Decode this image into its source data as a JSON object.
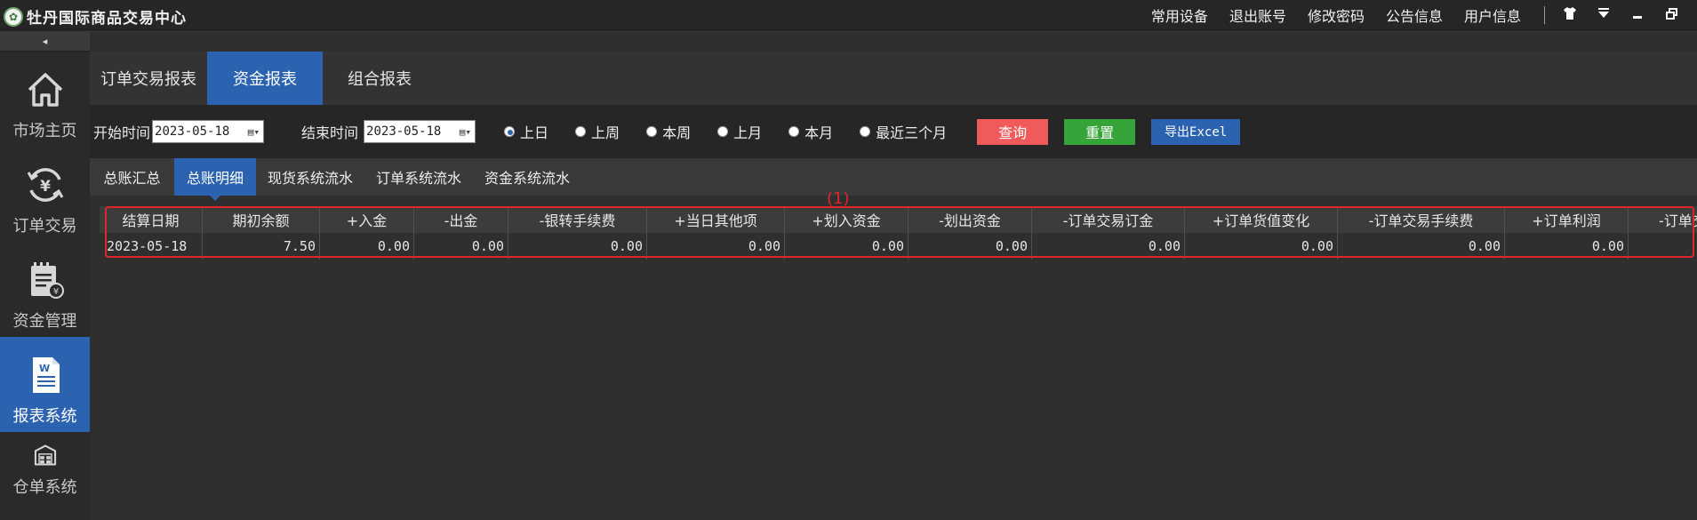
{
  "app": {
    "title": "牡丹国际商品交易中心"
  },
  "top_menu": [
    "常用设备",
    "退出账号",
    "修改密码",
    "公告信息",
    "用户信息"
  ],
  "sidebar": {
    "collapse_glyph": "◂",
    "items": [
      {
        "label": "市场主页",
        "icon": "home-icon"
      },
      {
        "label": "订单交易",
        "icon": "yen-cycle-icon"
      },
      {
        "label": "资金管理",
        "icon": "ledger-yen-icon"
      },
      {
        "label": "报表系统",
        "icon": "word-doc-icon",
        "active": true
      },
      {
        "label": "仓单系统",
        "icon": "warehouse-icon"
      }
    ]
  },
  "tabs": [
    {
      "label": "订单交易报表"
    },
    {
      "label": "资金报表",
      "active": true
    },
    {
      "label": "组合报表"
    }
  ],
  "filters": {
    "start_label": "开始时间",
    "start_value": "2023-05-18",
    "end_label": "结束时间",
    "end_value": "2023-05-18",
    "radios": [
      {
        "label": "上日",
        "checked": true
      },
      {
        "label": "上周"
      },
      {
        "label": "本周"
      },
      {
        "label": "上月"
      },
      {
        "label": "本月"
      },
      {
        "label": "最近三个月"
      }
    ],
    "query_label": "查询",
    "reset_label": "重置",
    "export_label": "导出Excel"
  },
  "subtabs": [
    {
      "label": "总账汇总"
    },
    {
      "label": "总账明细",
      "active": true
    },
    {
      "label": "现货系统流水"
    },
    {
      "label": "订单系统流水"
    },
    {
      "label": "资金系统流水"
    }
  ],
  "table": {
    "columns": [
      "结算日期",
      "期初余额",
      "+入金",
      "-出金",
      "-银转手续费",
      "+当日其他项",
      "+划入资金",
      "-划出资金",
      "-订单交易订金",
      "+订单货值变化",
      "-订单交易手续费",
      "+订单利润",
      "-订单交"
    ],
    "rows": [
      [
        "2023-05-18",
        "7.50",
        "0.00",
        "0.00",
        "0.00",
        "0.00",
        "0.00",
        "0.00",
        "0.00",
        "0.00",
        "0.00",
        "0.00",
        ""
      ]
    ]
  },
  "annotation": {
    "label": "(1)",
    "color": "#e0262a"
  },
  "colors": {
    "accent": "#2b63b0",
    "query": "#f05a5a",
    "reset": "#37a43a"
  }
}
